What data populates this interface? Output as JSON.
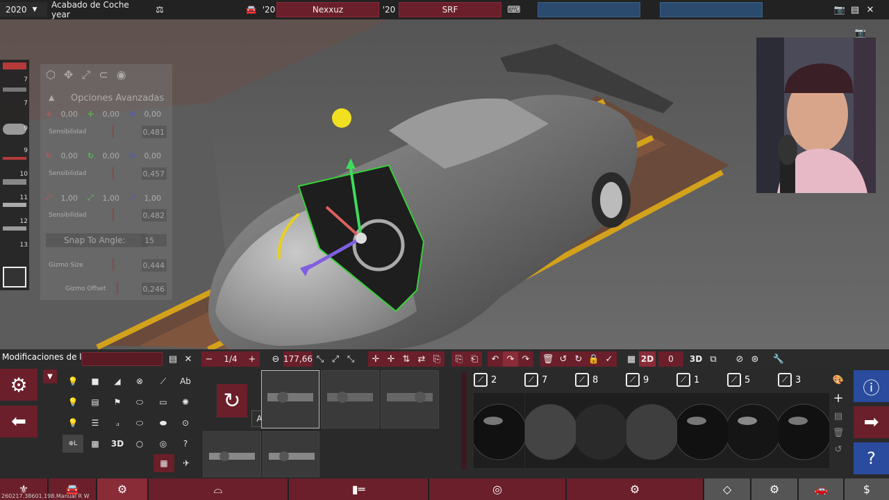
{
  "topbar": {
    "year_selector": "2020",
    "project_title": "Acabado de Coche year",
    "model_year_left": "'20",
    "author": "Nexxuz",
    "model_year_right": "'20",
    "trim": "SRF"
  },
  "advanced_options": {
    "title": "Opciones Avanzadas",
    "position": {
      "x": "0,00",
      "y": "0,00",
      "z": "0,00",
      "sensitivity_label": "Sensibilidad",
      "sensitivity": "0,481"
    },
    "rotation": {
      "x": "0,00",
      "y": "0,00",
      "z": "0,00",
      "sensitivity_label": "Sensibilidad",
      "sensitivity": "0,457"
    },
    "scale": {
      "x": "1,00",
      "y": "1,00",
      "z": "1,00",
      "sensitivity_label": "Sensibilidad",
      "sensitivity": "0,482"
    },
    "snap_label": "Snap To Angle:",
    "snap_value": "15",
    "gizmo_size_label": "Gizmo Size",
    "gizmo_size": "0,444",
    "gizmo_offset_label": "Gizmo Offset",
    "gizmo_offset": "0,246"
  },
  "thumb_numbers": [
    "7",
    "7",
    "9",
    "9",
    "10",
    "11",
    "12",
    "13"
  ],
  "toolrow": {
    "module_title": "Modificaciones de la IA",
    "page": "1/4",
    "angle": "177,66",
    "mode_2d": "2D",
    "layer_value": "0",
    "mode_3d": "3D"
  },
  "toolgrid": {
    "text_label": "Ab",
    "three_d_label": "3D"
  },
  "tooltip": "Atrás",
  "materials": [
    "2",
    "7",
    "8",
    "9",
    "1",
    "5",
    "3"
  ],
  "footer": "260217.38601.198.Manual R W",
  "colors": {
    "accent_red": "#6b1f2a",
    "accent_blue": "#2a4b6e",
    "panel": "#2a2a2a"
  }
}
